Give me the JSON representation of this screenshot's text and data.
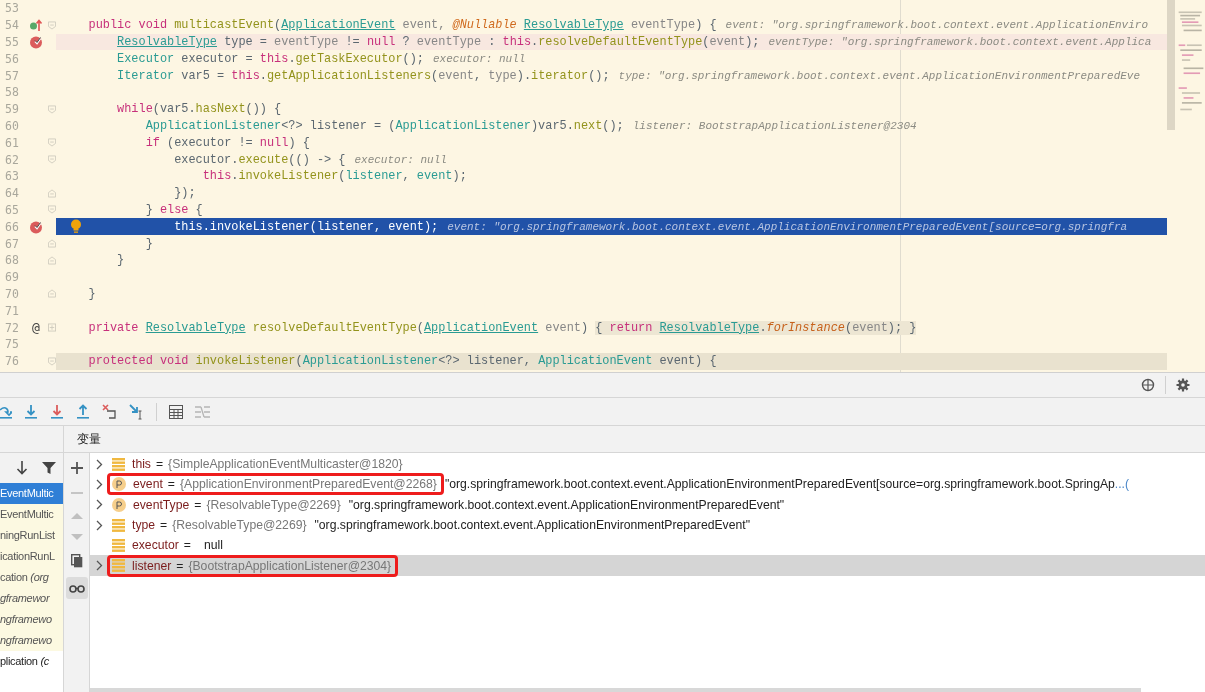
{
  "editor": {
    "lines": [
      {
        "number": "53"
      },
      {
        "number": "54",
        "override_marker": true,
        "fold_start": true,
        "tokens": [
          {
            "text": "    public void ",
            "kind": "kw"
          },
          {
            "text": "multicastEvent",
            "kind": "method"
          },
          {
            "text": "(",
            "kind": "plain"
          },
          {
            "text": "ApplicationEvent",
            "kind": "link"
          },
          {
            "text": " event, ",
            "kind": "param"
          },
          {
            "text": "@Nullable ",
            "kind": "annot"
          },
          {
            "text": "ResolvableType",
            "kind": "link"
          },
          {
            "text": " eventType",
            "kind": "param"
          },
          {
            "text": ") {",
            "kind": "plain"
          }
        ],
        "hint": "event: \"org.springframework.boot.context.event.ApplicationEnviro"
      },
      {
        "number": "55",
        "breakpoint": true,
        "execution_point": false,
        "tokens": [
          {
            "text": "        ResolvableType",
            "kind": "link"
          },
          {
            "text": " type = ",
            "kind": "plain"
          },
          {
            "text": "eventType",
            "kind": "param"
          },
          {
            "text": " != ",
            "kind": "plain"
          },
          {
            "text": "null",
            "kind": "kw"
          },
          {
            "text": " ? ",
            "kind": "plain"
          },
          {
            "text": "eventType",
            "kind": "param"
          },
          {
            "text": " : ",
            "kind": "plain"
          },
          {
            "text": "this",
            "kind": "kw"
          },
          {
            "text": ".",
            "kind": "plain"
          },
          {
            "text": "resolveDefaultEventType",
            "kind": "method"
          },
          {
            "text": "(",
            "kind": "plain"
          },
          {
            "text": "event",
            "kind": "param"
          },
          {
            "text": ");",
            "kind": "plain"
          }
        ],
        "hint": "eventType: \"org.springframework.boot.context.event.Applica"
      },
      {
        "number": "56",
        "tokens": [
          {
            "text": "        Executor",
            "kind": "type"
          },
          {
            "text": " executor = ",
            "kind": "plain"
          },
          {
            "text": "this",
            "kind": "kw"
          },
          {
            "text": ".",
            "kind": "plain"
          },
          {
            "text": "getTaskExecutor",
            "kind": "method"
          },
          {
            "text": "();",
            "kind": "plain"
          }
        ],
        "hint": "executor: null"
      },
      {
        "number": "57",
        "tokens": [
          {
            "text": "        Iterator",
            "kind": "type"
          },
          {
            "text": " var5 = ",
            "kind": "plain"
          },
          {
            "text": "this",
            "kind": "kw"
          },
          {
            "text": ".",
            "kind": "plain"
          },
          {
            "text": "getApplicationListeners",
            "kind": "method"
          },
          {
            "text": "(",
            "kind": "plain"
          },
          {
            "text": "event",
            "kind": "param"
          },
          {
            "text": ", ",
            "kind": "plain"
          },
          {
            "text": "type",
            "kind": "param"
          },
          {
            "text": ").",
            "kind": "plain"
          },
          {
            "text": "iterator",
            "kind": "method"
          },
          {
            "text": "();",
            "kind": "plain"
          }
        ],
        "hint": "type: \"org.springframework.boot.context.event.ApplicationEnvironmentPreparedEve"
      },
      {
        "number": "58"
      },
      {
        "number": "59",
        "fold_start": true,
        "tokens": [
          {
            "text": "        while",
            "kind": "kw"
          },
          {
            "text": "(var5.",
            "kind": "plain"
          },
          {
            "text": "hasNext",
            "kind": "method"
          },
          {
            "text": "()) {",
            "kind": "plain"
          }
        ]
      },
      {
        "number": "60",
        "tokens": [
          {
            "text": "            ApplicationListener",
            "kind": "type"
          },
          {
            "text": "<?> listener = (",
            "kind": "plain"
          },
          {
            "text": "ApplicationListener",
            "kind": "type"
          },
          {
            "text": ")var5.",
            "kind": "plain"
          },
          {
            "text": "next",
            "kind": "method"
          },
          {
            "text": "();",
            "kind": "plain"
          }
        ],
        "hint": "listener: BootstrapApplicationListener@2304"
      },
      {
        "number": "61",
        "fold_start": true,
        "tokens": [
          {
            "text": "            if",
            "kind": "kw"
          },
          {
            "text": " (executor != ",
            "kind": "plain"
          },
          {
            "text": "null",
            "kind": "kw"
          },
          {
            "text": ") {",
            "kind": "plain"
          }
        ]
      },
      {
        "number": "62",
        "fold_start": true,
        "tokens": [
          {
            "text": "                executor.",
            "kind": "plain"
          },
          {
            "text": "execute",
            "kind": "method"
          },
          {
            "text": "(() -> {",
            "kind": "plain"
          }
        ],
        "hint": "executor: null"
      },
      {
        "number": "63",
        "tokens": [
          {
            "text": "                    this",
            "kind": "kw"
          },
          {
            "text": ".",
            "kind": "plain"
          },
          {
            "text": "invokeListener",
            "kind": "method"
          },
          {
            "text": "(",
            "kind": "plain"
          },
          {
            "text": "listener",
            "kind": "type"
          },
          {
            "text": ", ",
            "kind": "plain"
          },
          {
            "text": "event",
            "kind": "type"
          },
          {
            "text": ");",
            "kind": "plain"
          }
        ]
      },
      {
        "number": "64",
        "fold_end": true,
        "tokens": [
          {
            "text": "                });",
            "kind": "plain"
          }
        ]
      },
      {
        "number": "65",
        "fold_start": true,
        "tokens": [
          {
            "text": "            } ",
            "kind": "plain"
          },
          {
            "text": "else",
            "kind": "kw"
          },
          {
            "text": " {",
            "kind": "plain"
          }
        ]
      },
      {
        "number": "66",
        "breakpoint": true,
        "execution_point": true,
        "bulb": true,
        "tokens": [
          {
            "text": "                this.invokeListener(listener, event);",
            "kind": "plain"
          }
        ],
        "hint": "event: \"org.springframework.boot.context.event.ApplicationEnvironmentPreparedEvent[source=org.springfra"
      },
      {
        "number": "67",
        "fold_end": true,
        "tokens": [
          {
            "text": "            }",
            "kind": "plain"
          }
        ]
      },
      {
        "number": "68",
        "fold_end": true,
        "tokens": [
          {
            "text": "        }",
            "kind": "plain"
          }
        ]
      },
      {
        "number": "69"
      },
      {
        "number": "70",
        "fold_end": true,
        "tokens": [
          {
            "text": "    }",
            "kind": "plain"
          }
        ]
      },
      {
        "number": "71"
      },
      {
        "number": "72",
        "gutter_text": "@",
        "folded": true,
        "tokens": [
          {
            "text": "    private ",
            "kind": "kw"
          },
          {
            "text": "ResolvableType",
            "kind": "link"
          },
          {
            "text": " resolveDefaultEventType",
            "kind": "method"
          },
          {
            "text": "(",
            "kind": "plain"
          },
          {
            "text": "ApplicationEvent",
            "kind": "link"
          },
          {
            "text": " event",
            "kind": "param"
          },
          {
            "text": ") ",
            "kind": "plain"
          },
          {
            "text": "{ ",
            "kind": "fold-plain"
          },
          {
            "text": "return ",
            "kind": "fold-kw"
          },
          {
            "text": "ResolvableType",
            "kind": "fold-link"
          },
          {
            "text": ".",
            "kind": "fold-plain"
          },
          {
            "text": "forInstance",
            "kind": "fold-imethod"
          },
          {
            "text": "(",
            "kind": "fold-plain"
          },
          {
            "text": "event",
            "kind": "fold-param"
          },
          {
            "text": "); }",
            "kind": "fold-plain"
          }
        ]
      },
      {
        "number": "75"
      },
      {
        "number": "76",
        "dimmed": true,
        "fold_start": true,
        "tokens": [
          {
            "text": "    protected void ",
            "kind": "kw"
          },
          {
            "text": "invokeListener",
            "kind": "method"
          },
          {
            "text": "(",
            "kind": "plain"
          },
          {
            "text": "ApplicationListener",
            "kind": "type"
          },
          {
            "text": "<?> listener, ",
            "kind": "plain"
          },
          {
            "text": "ApplicationEvent",
            "kind": "type"
          },
          {
            "text": " event) {",
            "kind": "plain"
          }
        ]
      }
    ]
  },
  "debugger": {
    "panel_tab": "变量",
    "frames": [
      {
        "text": "EventMultic",
        "selected": true
      },
      {
        "text": "EventMultic",
        "selected": false,
        "library": true
      },
      {
        "text": "ningRunList",
        "selected": false,
        "library": true
      },
      {
        "text": "icationRunL",
        "selected": false,
        "library": true
      },
      {
        "text": "cation *(org*",
        "selected": false,
        "library": true
      },
      {
        "text": "*gframewor*",
        "selected": false,
        "library": true
      },
      {
        "text": "*ngframewo*",
        "selected": false,
        "library": true
      },
      {
        "text": "*ngframewo*",
        "selected": false,
        "library": true
      },
      {
        "text": "plication *(c*",
        "selected": false,
        "library": false
      }
    ],
    "variables": [
      {
        "name": "this",
        "kind": "field",
        "expandable": true,
        "selected": false,
        "boxed": false,
        "separator": "=",
        "ref": "{SimpleApplicationEventMulticaster@1820}"
      },
      {
        "name": "event",
        "kind": "param",
        "expandable": true,
        "selected": false,
        "boxed": true,
        "separator": "=",
        "ref": "{ApplicationEnvironmentPreparedEvent@2268}",
        "value": "\"org.springframework.boot.context.event.ApplicationEnvironmentPreparedEvent[source=org.springframework.boot.SpringAp",
        "link": "...("
      },
      {
        "name": "eventType",
        "kind": "param",
        "expandable": true,
        "selected": false,
        "boxed": false,
        "separator": "=",
        "ref": "{ResolvableType@2269}",
        "value": "\"org.springframework.boot.context.event.ApplicationEnvironmentPreparedEvent\""
      },
      {
        "name": "type",
        "kind": "field",
        "expandable": true,
        "selected": false,
        "boxed": false,
        "separator": "=",
        "ref": "{ResolvableType@2269}",
        "value": "\"org.springframework.boot.context.event.ApplicationEnvironmentPreparedEvent\""
      },
      {
        "name": "executor",
        "kind": "field",
        "expandable": false,
        "selected": false,
        "boxed": false,
        "separator": "=",
        "value": "null"
      },
      {
        "name": "listener",
        "kind": "field",
        "expandable": true,
        "selected": true,
        "boxed": true,
        "separator": "=",
        "ref": "{BootstrapApplicationListener@2304}"
      }
    ]
  }
}
